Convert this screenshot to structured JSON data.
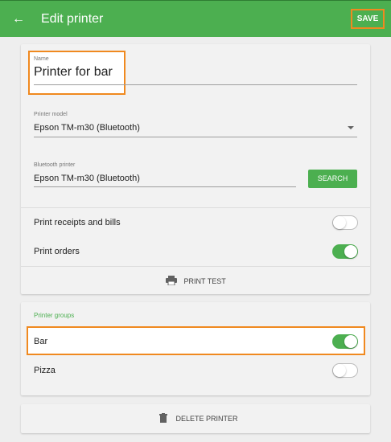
{
  "appbar": {
    "title": "Edit printer",
    "save_label": "SAVE"
  },
  "printer": {
    "name_label": "Name",
    "name_value": "Printer for bar",
    "model_label": "Printer model",
    "model_value": "Epson TM-m30 (Bluetooth)",
    "bluetooth_label": "Bluetooth printer",
    "bluetooth_value": "Epson TM-m30 (Bluetooth)",
    "search_label": "SEARCH",
    "options": [
      {
        "label": "Print receipts and bills",
        "enabled": false
      },
      {
        "label": "Print orders",
        "enabled": true
      }
    ],
    "print_test_label": "PRINT TEST"
  },
  "groups": {
    "title": "Printer groups",
    "items": [
      {
        "label": "Bar",
        "enabled": true
      },
      {
        "label": "Pizza",
        "enabled": false
      }
    ]
  },
  "delete_label": "DELETE PRINTER",
  "colors": {
    "accent": "#4caf50",
    "highlight": "#f0891f"
  }
}
